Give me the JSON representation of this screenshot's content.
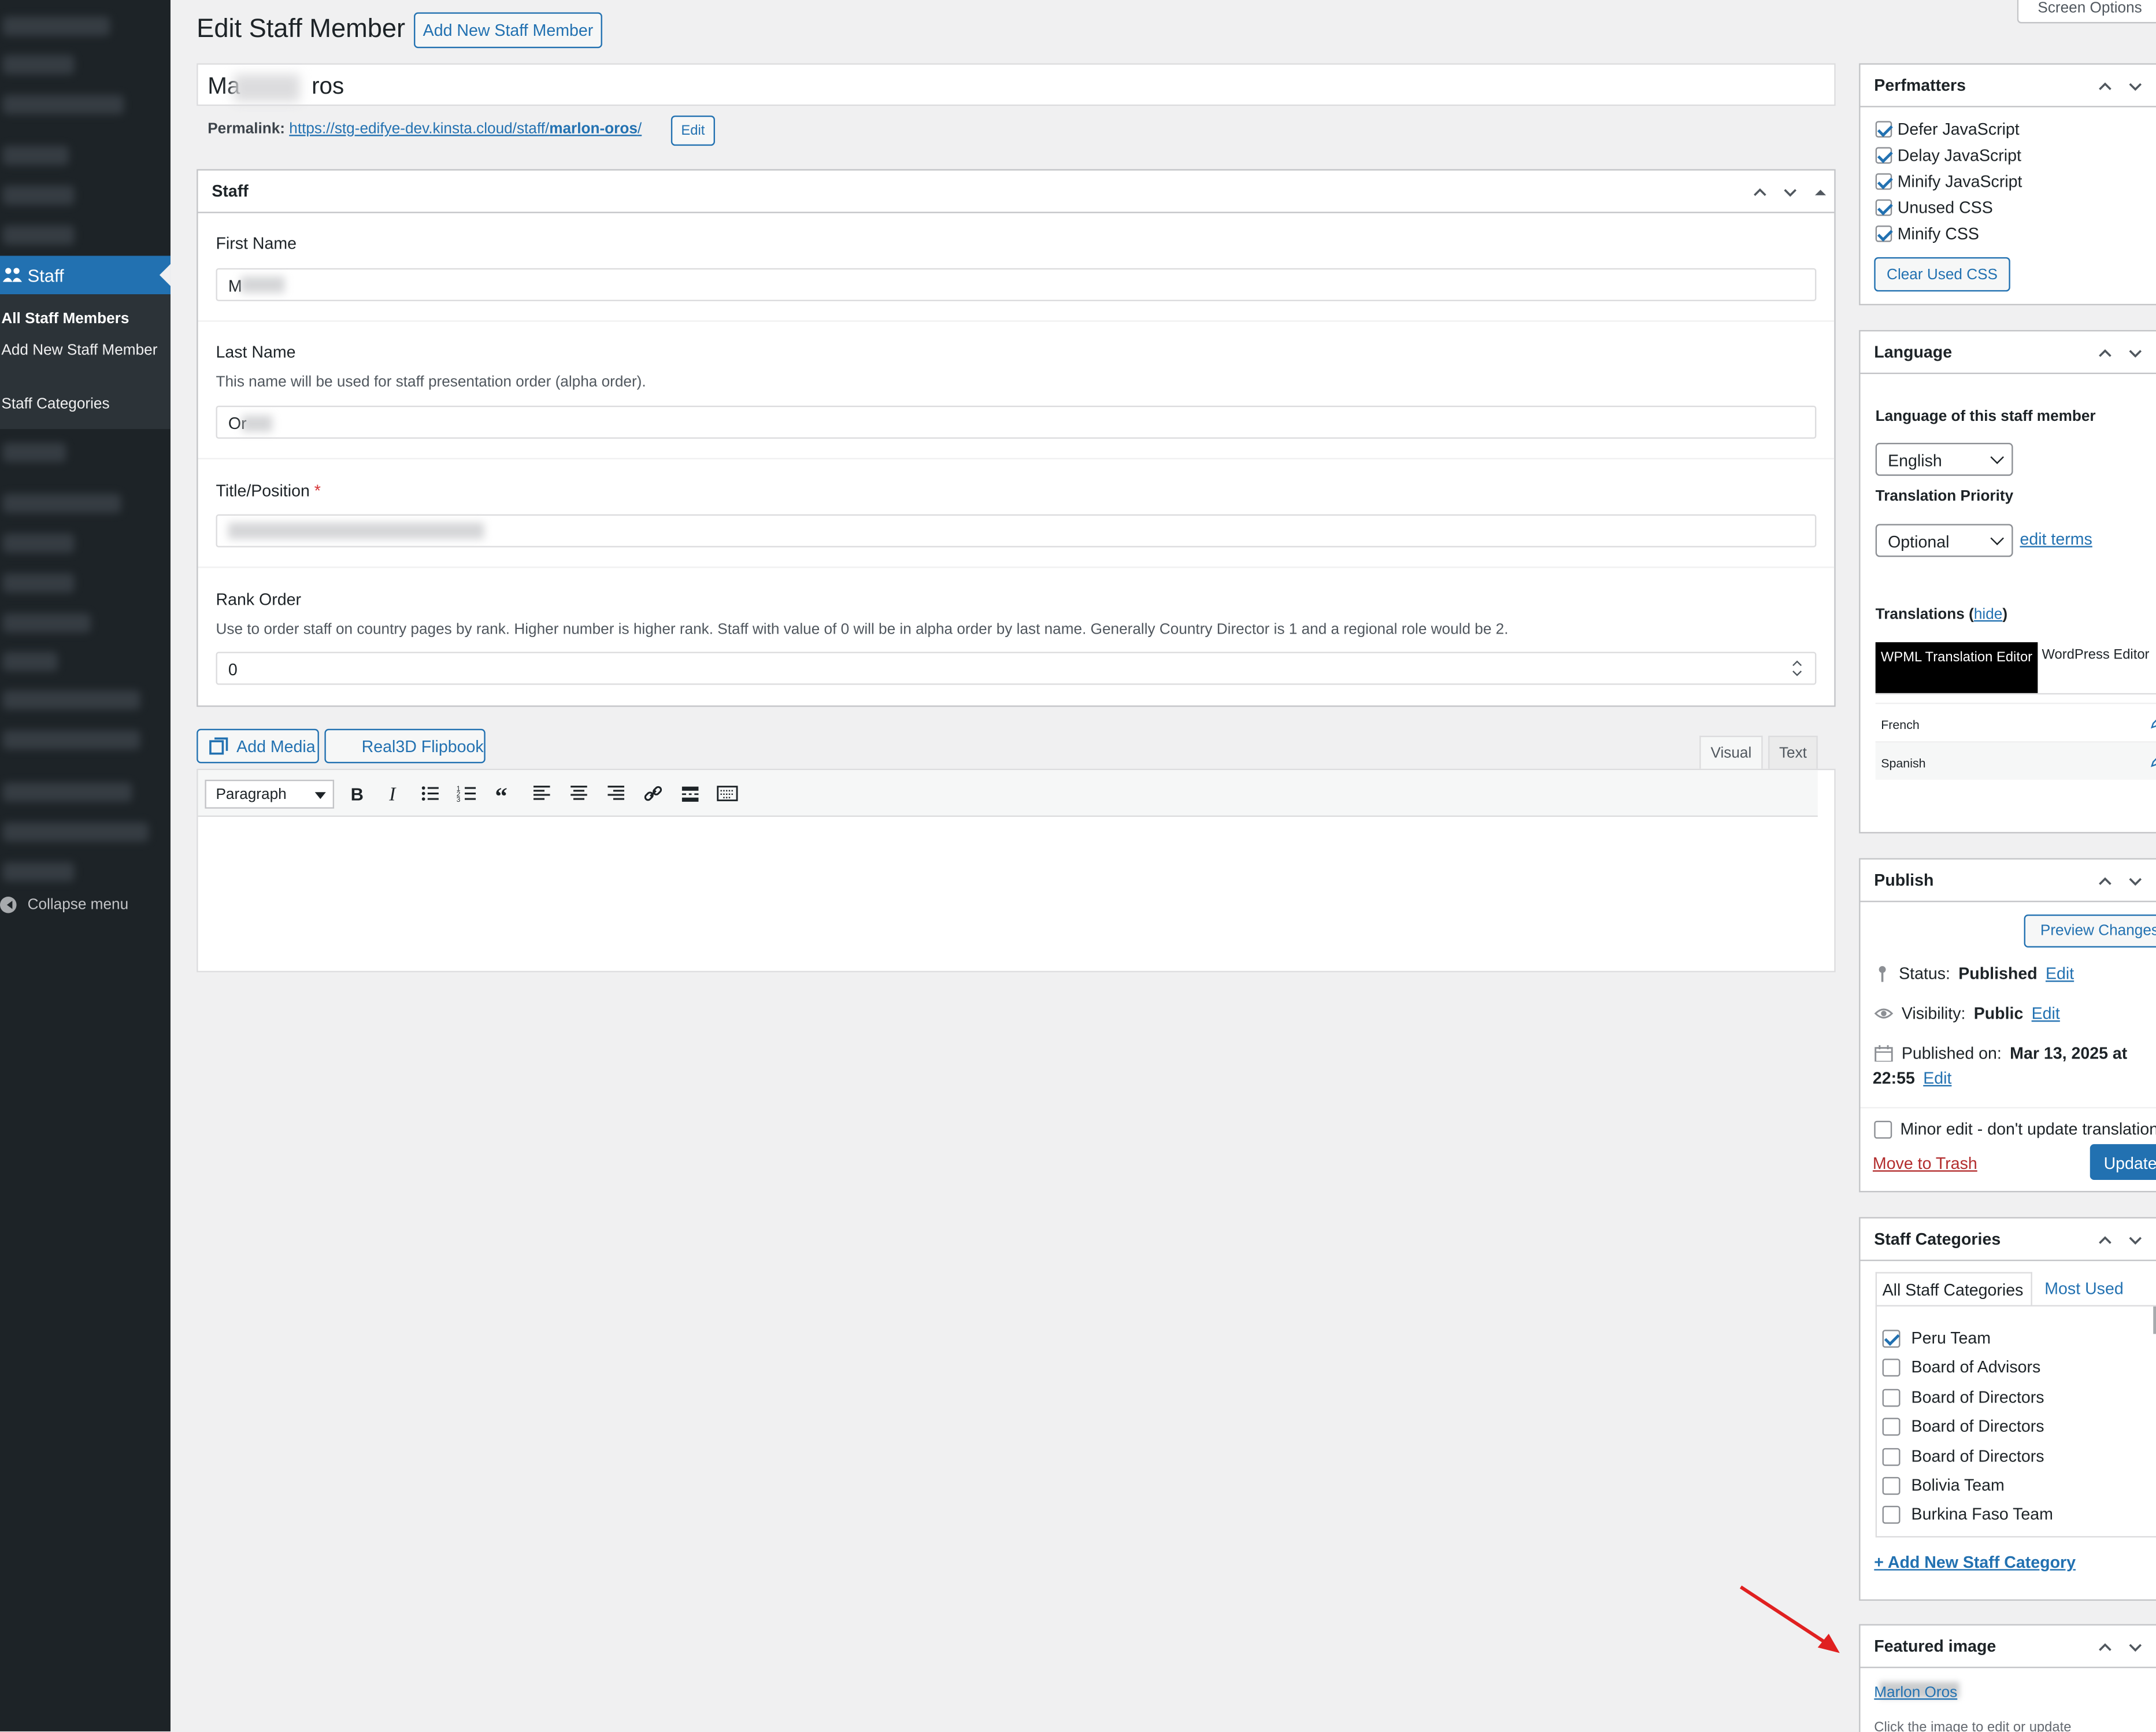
{
  "sidebar_menu": {
    "staff_label": "Staff",
    "submenu": [
      "All Staff Members",
      "Add New Staff Member",
      "Staff Categories"
    ],
    "collapse_label": "Collapse menu"
  },
  "header": {
    "title": "Edit Staff Member",
    "add_new_label": "Add New Staff Member",
    "screen_options": "Screen Options"
  },
  "post": {
    "title_prefix": "Ma",
    "title_suffix": "ros",
    "permalink_label": "Permalink:",
    "permalink_base": "https://stg-edifye-dev.kinsta.cloud/staff/",
    "permalink_slug": "marlon-oros",
    "permalink_end": "/",
    "permalink_edit": "Edit"
  },
  "staff_box": {
    "title": "Staff",
    "first_name_label": "First Name",
    "first_name_value": "M",
    "last_name_label": "Last Name",
    "last_name_desc": "This name will be used for staff presentation order (alpha order).",
    "last_name_value": "Or",
    "title_label": "Title/Position",
    "required_mark": "*",
    "rank_label": "Rank Order",
    "rank_desc": "Use to order staff on country pages by rank. Higher number is higher rank. Staff with value of 0 will be in alpha order by last name. Generally Country Director is 1 and a regional role would be 2.",
    "rank_value": "0"
  },
  "editor": {
    "add_media": "Add Media",
    "flipbook": "Real3D Flipbook",
    "tab_visual": "Visual",
    "tab_text": "Text",
    "format": "Paragraph"
  },
  "perfmatters": {
    "title": "Perfmatters",
    "options": [
      {
        "label": "Defer JavaScript",
        "checked": true
      },
      {
        "label": "Delay JavaScript",
        "checked": true
      },
      {
        "label": "Minify JavaScript",
        "checked": true
      },
      {
        "label": "Unused CSS",
        "checked": true
      },
      {
        "label": "Minify CSS",
        "checked": true
      }
    ],
    "clear_button": "Clear Used CSS"
  },
  "language": {
    "title": "Language",
    "lang_label": "Language of this staff member",
    "lang_value": "English",
    "priority_label": "Translation Priority",
    "priority_value": "Optional",
    "edit_terms": "edit terms",
    "translations_label": "Translations (",
    "translations_hide": "hide",
    "translations_close": ")",
    "tab_wpml": "WPML Translation Editor",
    "tab_wp": "WordPress Editor",
    "rows": [
      "French",
      "Spanish"
    ]
  },
  "publish": {
    "title": "Publish",
    "preview": "Preview Changes",
    "status_label": "Status:",
    "status_value": "Published",
    "visibility_label": "Visibility:",
    "visibility_value": "Public",
    "published_label": "Published on:",
    "published_value": "Mar 13, 2025 at",
    "published_time": "22:55",
    "edit": "Edit",
    "minor_edit": "Minor edit - don't update translation",
    "trash": "Move to Trash",
    "update": "Update"
  },
  "categories": {
    "title": "Staff Categories",
    "tab_all": "All Staff Categories",
    "tab_most": "Most Used",
    "items": [
      {
        "label": "Peru Team",
        "checked": true
      },
      {
        "label": "Board of Advisors",
        "checked": false
      },
      {
        "label": "Board of Directors",
        "checked": false
      },
      {
        "label": "Board of Directors",
        "checked": false
      },
      {
        "label": "Board of Directors",
        "checked": false
      },
      {
        "label": "Bolivia Team",
        "checked": false
      },
      {
        "label": "Burkina Faso Team",
        "checked": false
      }
    ],
    "add_new": "+ Add New Staff Category"
  },
  "featured": {
    "title": "Featured image",
    "image_alt": "Marlon Oros",
    "hint": "Click the image to edit or update"
  },
  "colors": {
    "accent": "#2271b1",
    "menu_bg": "#1d2327",
    "trash": "#b32d2e",
    "arrow": "#e02020"
  }
}
